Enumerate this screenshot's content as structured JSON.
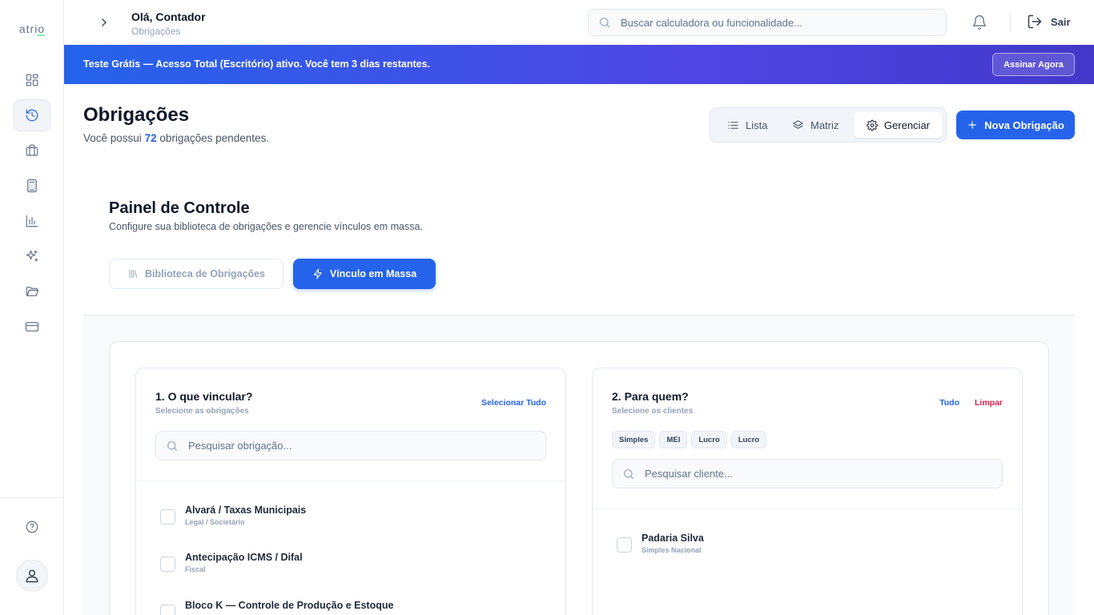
{
  "sidebar": {
    "logo": "atrio",
    "icons": [
      "dashboard-icon",
      "history-icon",
      "briefcase-icon",
      "calculator-icon",
      "chart-icon",
      "sparkles-icon",
      "folder-icon",
      "credit-card-icon",
      "help-icon",
      "user-icon"
    ],
    "active": "history-icon"
  },
  "header": {
    "greeting": "Olá, Contador",
    "subtitle": "Obrigações",
    "search_placeholder": "Buscar calculadora ou funcionalidade...",
    "logout_label": "Sair"
  },
  "banner": {
    "text": "Teste Grátis — Acesso Total (Escritório) ativo. Você tem 3 dias restantes.",
    "button_label": "Assinar Agora"
  },
  "page": {
    "title": "Obrigações",
    "subtitle_prefix": "Você possui",
    "pending_count": "72",
    "subtitle_suffix": "obrigações pendentes.",
    "views": [
      {
        "label": "Lista",
        "icon": "list-icon"
      },
      {
        "label": "Matriz",
        "icon": "layers-icon"
      },
      {
        "label": "Gerenciar",
        "icon": "gear-icon",
        "active": true
      }
    ],
    "new_button_label": "Nova Obrigação"
  },
  "panel": {
    "title": "Painel de Controle",
    "subtitle": "Configure sua biblioteca de obrigações e gerencie vínculos em massa.",
    "tab_library": "Biblioteca de Obrigações",
    "tab_mass": "Vínculo em Massa"
  },
  "left_column": {
    "title": "1. O que vincular?",
    "subtitle": "Selecione as obrigações",
    "select_all": "Selecionar Tudo",
    "search_placeholder": "Pesquisar obrigação...",
    "items": [
      {
        "title": "Alvará / Taxas Municipais",
        "category": "Legal / Societário"
      },
      {
        "title": "Antecipação ICMS / Difal",
        "category": "Fiscal"
      },
      {
        "title": "Bloco K — Controle de Produção e Estoque",
        "category": ""
      }
    ]
  },
  "right_column": {
    "title": "2. Para quem?",
    "subtitle": "Selecione os clientes",
    "all_label": "Tudo",
    "clear_label": "Limpar",
    "chips": [
      "Simples",
      "MEI",
      "Lucro",
      "Lucro"
    ],
    "search_placeholder": "Pesquisar cliente...",
    "items": [
      {
        "title": "Padaria Silva",
        "category": "Simples Nacional"
      }
    ]
  },
  "colors": {
    "accent": "#2563eb",
    "danger": "#e11d48",
    "banner_start": "#2563eb",
    "banner_end": "#4338ca"
  }
}
